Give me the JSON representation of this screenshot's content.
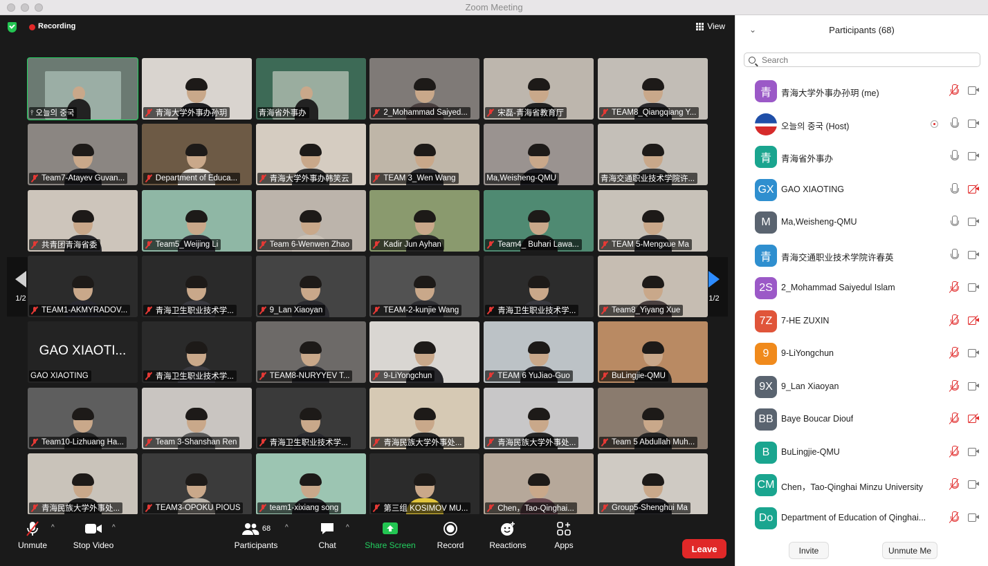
{
  "window": {
    "title": "Zoom Meeting"
  },
  "topbar": {
    "recording_label": "Recording",
    "view_label": "View"
  },
  "pager": {
    "left_label": "1/2",
    "right_label": "1/2"
  },
  "tiles": [
    {
      "name": "오늘의 중국",
      "pinned": true,
      "muted": false,
      "active": true,
      "bg": "#6b7a72",
      "shirt": "#c2d8d0",
      "type": "screen"
    },
    {
      "name": "青海大学外事办孙玥",
      "muted": true,
      "bg": "#d9d4cf",
      "shirt": "#1e1e22"
    },
    {
      "name": "青海省外事办",
      "muted": false,
      "bg": "#3d6a56",
      "shirt": "#e8e3dc",
      "type": "screen"
    },
    {
      "name": "2_Mohammad Saiyed...",
      "muted": true,
      "bg": "#7f7a77",
      "shirt": "#4a4040"
    },
    {
      "name": "宋磊-青海省教育厅",
      "muted": true,
      "bg": "#bdb6ad",
      "shirt": "#222"
    },
    {
      "name": "TEAM8_Qiangqiang Y...",
      "muted": true,
      "bg": "#c2bdb6",
      "shirt": "#2b2b2f"
    },
    {
      "name": "Team7-Atayev Guvan...",
      "muted": true,
      "bg": "#8b8682",
      "shirt": "#26262a"
    },
    {
      "name": "Department of Educa...",
      "muted": true,
      "bg": "#6d5a45",
      "shirt": "#e4ded6"
    },
    {
      "name": "青海大学外事办韩笑云",
      "muted": true,
      "bg": "#d5ccc1",
      "shirt": "#333"
    },
    {
      "name": "TEAM 3_Wen Wang",
      "muted": true,
      "bg": "#bfb6a8",
      "shirt": "#2d2d31"
    },
    {
      "name": "Ma,Weisheng-QMU",
      "muted": false,
      "bg": "#9a9390",
      "shirt": "#1f1f24"
    },
    {
      "name": "青海交通职业技术学院许...",
      "muted": false,
      "bg": "#c4bfb8",
      "shirt": "#3a3a3a"
    },
    {
      "name": "共青团青海省委",
      "muted": true,
      "bg": "#cdc5bb",
      "shirt": "#2a2a2e"
    },
    {
      "name": "Team5_Weijing Li",
      "muted": true,
      "bg": "#8fb7a5",
      "shirt": "#2f2f35"
    },
    {
      "name": "Team 6-Wenwen Zhao",
      "muted": true,
      "bg": "#bcb4ab",
      "shirt": "#c9c1b7"
    },
    {
      "name": "Kadir Jun Ayhan",
      "muted": true,
      "bg": "#8a9a6e",
      "shirt": "#262626"
    },
    {
      "name": "Team4_ Buhari Lawa...",
      "muted": true,
      "bg": "#4f8a72",
      "shirt": "#1b1b1b"
    },
    {
      "name": "TEAM 5-Mengxue Ma",
      "muted": true,
      "bg": "#c8c2b9",
      "shirt": "#2a2a2e"
    },
    {
      "name": "TEAM1-AKMYRADOV...",
      "muted": true,
      "bg": "#2b2b2b",
      "shirt": "#2b2b33"
    },
    {
      "name": "青海卫生职业技术学...",
      "muted": true,
      "bg": "#2a2a2a",
      "shirt": "#3a3a40"
    },
    {
      "name": "9_Lan Xiaoyan",
      "muted": true,
      "bg": "#444444",
      "shirt": "#2b2b30"
    },
    {
      "name": "TEAM-2-kunjie Wang",
      "muted": true,
      "bg": "#525252",
      "shirt": "#2f2f33"
    },
    {
      "name": "青海卫生职业技术学...",
      "muted": true,
      "bg": "#2c2c2c",
      "shirt": "#3a3a40"
    },
    {
      "name": "Team8_Yiyang Xue",
      "muted": true,
      "bg": "#c6bdb2",
      "shirt": "#4a4040"
    },
    {
      "name": "GAO XIAOTING",
      "muted": false,
      "bg": "#232323",
      "avatar_text": "GAO XIAOTI..."
    },
    {
      "name": "青海卫生职业技术学...",
      "muted": true,
      "bg": "#2a2a2a",
      "shirt": "#3a3a40"
    },
    {
      "name": "TEAM8-NURYYEV T...",
      "muted": true,
      "bg": "#6d6a68",
      "shirt": "#26262a"
    },
    {
      "name": "9-LiYongchun",
      "muted": true,
      "bg": "#d9d6d2",
      "shirt": "#26262a"
    },
    {
      "name": "TEAM 6 YuJiao-Guo",
      "muted": true,
      "bg": "#bcc2c6",
      "shirt": "#2b2b30"
    },
    {
      "name": "BuLingjie-QMU",
      "muted": true,
      "bg": "#b98a63",
      "shirt": "#222"
    },
    {
      "name": "Team10-Lizhuang Ha...",
      "muted": true,
      "bg": "#5e5e5e",
      "shirt": "#222"
    },
    {
      "name": "Team 3-Shanshan Ren",
      "muted": true,
      "bg": "#c9c5c1",
      "shirt": "#5a5a5a"
    },
    {
      "name": "青海卫生职业技术学...",
      "muted": true,
      "bg": "#3a3a3a",
      "shirt": "#2b2b30"
    },
    {
      "name": "青海民族大学外事处...",
      "muted": true,
      "bg": "#d6c9b4",
      "shirt": "#262626"
    },
    {
      "name": "青海民族大学外事处...",
      "muted": true,
      "bg": "#c8c7c8",
      "shirt": "#262626"
    },
    {
      "name": "Team 5 Abdullah Muh...",
      "muted": true,
      "bg": "#8a7b6e",
      "shirt": "#262626"
    },
    {
      "name": "青海民族大学外事处...",
      "muted": true,
      "bg": "#c9c3ba",
      "shirt": "#222"
    },
    {
      "name": "TEAM3-OPOKU PIOUS",
      "muted": true,
      "bg": "#3b3b3b",
      "shirt": "#b9b3aa"
    },
    {
      "name": "team1-xixiang song",
      "muted": true,
      "bg": "#9cc5b2",
      "shirt": "#26262a"
    },
    {
      "name": "第三组 KOSIMOV MU...",
      "muted": true,
      "bg": "#2b2b2b",
      "shirt": "#e1c43a"
    },
    {
      "name": "Chen，Tao-Qinghai...",
      "muted": true,
      "bg": "#b6a89a",
      "shirt": "#6a4a52"
    },
    {
      "name": "Group5-Shenghui Ma",
      "muted": true,
      "bg": "#cfcac3",
      "shirt": "#26262a"
    }
  ],
  "toolbar": {
    "unmute_label": "Unmute",
    "stop_video_label": "Stop Video",
    "participants_label": "Participants",
    "participants_count": "68",
    "chat_label": "Chat",
    "share_screen_label": "Share Screen",
    "record_label": "Record",
    "reactions_label": "Reactions",
    "apps_label": "Apps",
    "leave_label": "Leave"
  },
  "panel": {
    "title": "Participants (68)",
    "search_placeholder": "Search",
    "invite_label": "Invite",
    "unmute_me_label": "Unmute Me",
    "participants": [
      {
        "initials": "青",
        "name": "青海大学外事办孙玥 (me)",
        "color": "#9b59c7",
        "mic": "muted",
        "cam": "on"
      },
      {
        "initials": "",
        "name": "오늘의 중국 (Host)",
        "color": "#1f4fa8",
        "mic": "on",
        "cam": "on",
        "recording": true,
        "logo": true
      },
      {
        "initials": "青",
        "name": "青海省外事办",
        "color": "#1aa58f",
        "mic": "on",
        "cam": "on"
      },
      {
        "initials": "GX",
        "name": "GAO XIAOTING",
        "color": "#2f8fcf",
        "mic": "on",
        "cam": "off"
      },
      {
        "initials": "M",
        "name": "Ma,Weisheng-QMU",
        "color": "#5a6470",
        "mic": "on",
        "cam": "on"
      },
      {
        "initials": "青",
        "name": "青海交通职业技术学院许春英",
        "color": "#2f8fcf",
        "mic": "on",
        "cam": "on"
      },
      {
        "initials": "2S",
        "name": "2_Mohammad Saiyedul Islam",
        "color": "#9b59c7",
        "mic": "muted",
        "cam": "on"
      },
      {
        "initials": "7Z",
        "name": "7-HE ZUXIN",
        "color": "#e0553a",
        "mic": "muted",
        "cam": "off"
      },
      {
        "initials": "9",
        "name": "9-LiYongchun",
        "color": "#f08a1c",
        "mic": "muted",
        "cam": "on"
      },
      {
        "initials": "9X",
        "name": "9_Lan Xiaoyan",
        "color": "#5a6470",
        "mic": "muted",
        "cam": "on"
      },
      {
        "initials": "BB",
        "name": "Baye Boucar Diouf",
        "color": "#5a6470",
        "mic": "muted",
        "cam": "off"
      },
      {
        "initials": "B",
        "name": "BuLingjie-QMU",
        "color": "#1aa58f",
        "mic": "muted",
        "cam": "on"
      },
      {
        "initials": "CM",
        "name": "Chen，Tao-Qinghai Minzu University",
        "color": "#1aa58f",
        "mic": "muted",
        "cam": "on"
      },
      {
        "initials": "Do",
        "name": "Department of Education of Qinghai...",
        "color": "#1aa58f",
        "mic": "muted",
        "cam": "on"
      }
    ]
  }
}
